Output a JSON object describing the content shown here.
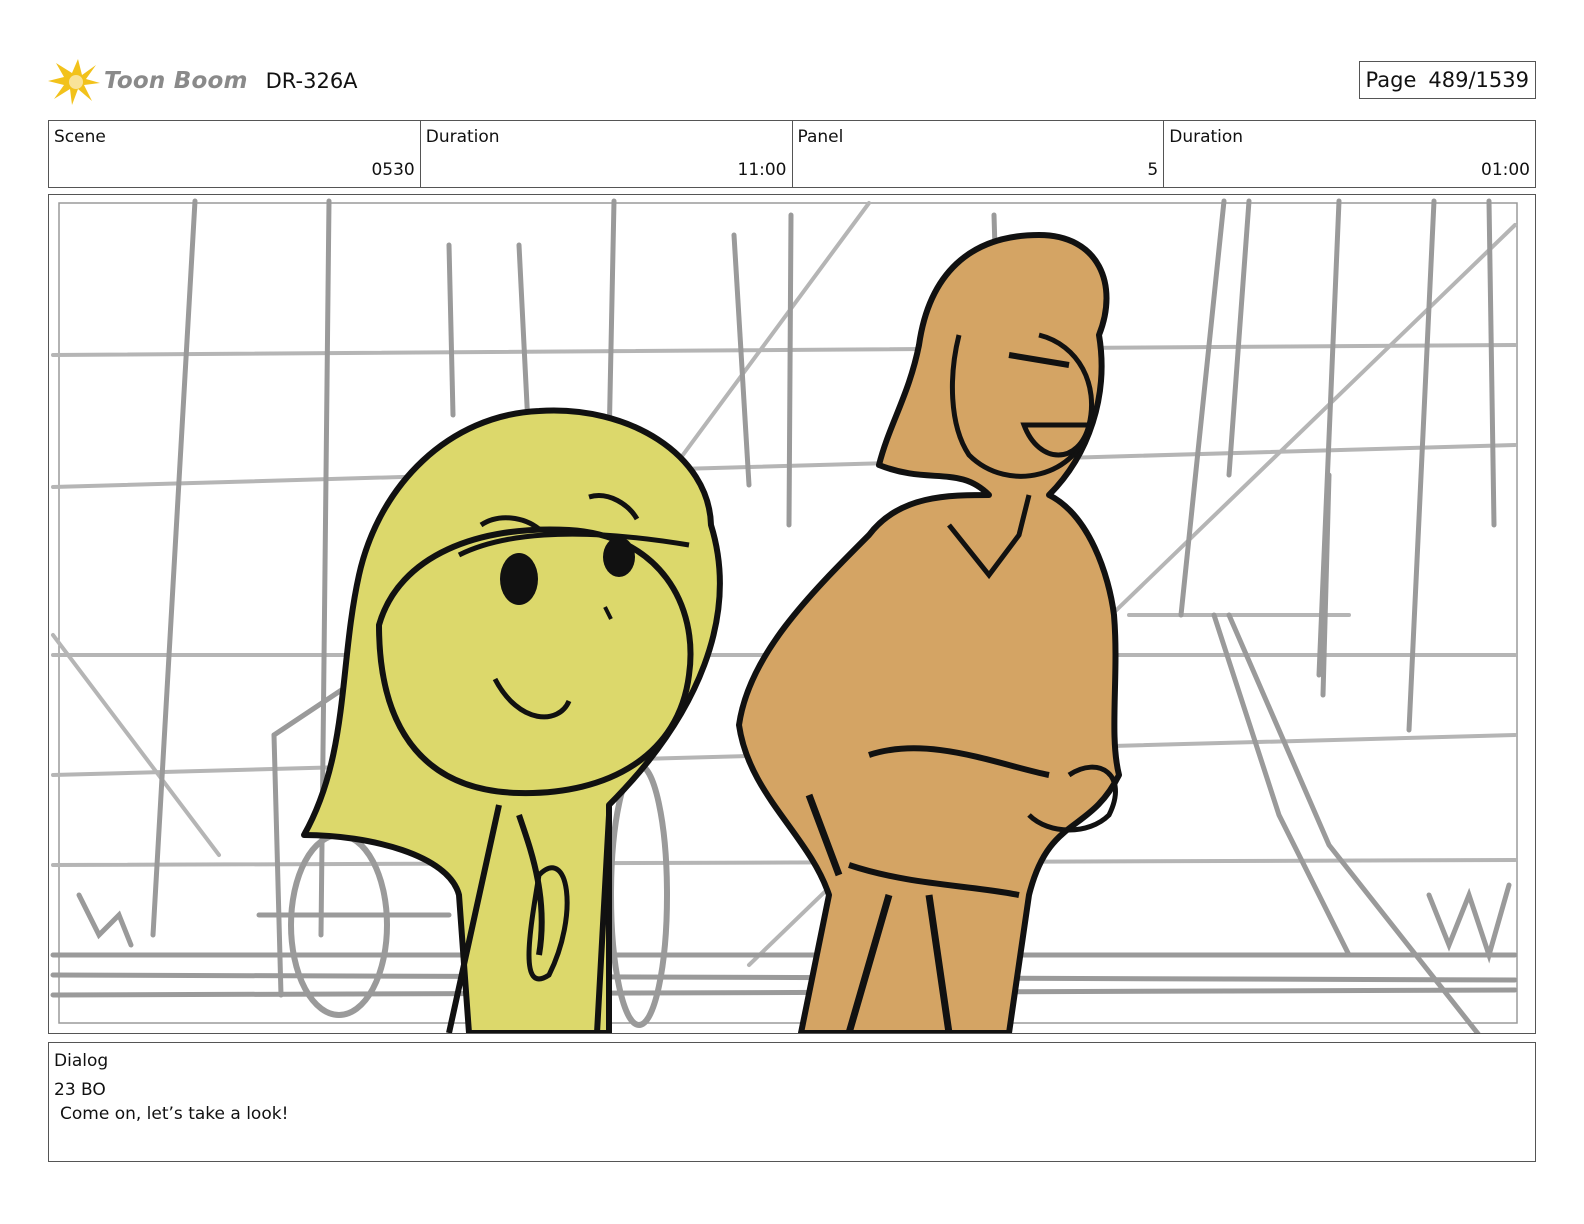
{
  "header": {
    "logo_text": "Toon Boom",
    "project_code": "DR-326A",
    "page_label": "Page",
    "page_value": "489/1539"
  },
  "info": [
    {
      "label": "Scene",
      "value": "0530"
    },
    {
      "label": "Duration",
      "value": "11:00"
    },
    {
      "label": "Panel",
      "value": "5"
    },
    {
      "label": "Duration",
      "value": "01:00"
    }
  ],
  "panel": {
    "image": "storyboard sketch: girl with yellow hair and a man in tan clothes in front of a wagon",
    "colors": {
      "girl_fill": "#dcd86b",
      "man_fill": "#d4a464",
      "sketch_gray": "#9a9a9a",
      "ink": "#111111"
    }
  },
  "dialog": {
    "label": "Dialog",
    "speaker": "23 BO",
    "line": "Come on, let’s take a look!"
  },
  "logo_colors": {
    "burst": "#f2c21b",
    "text": "#8a8a8a"
  }
}
